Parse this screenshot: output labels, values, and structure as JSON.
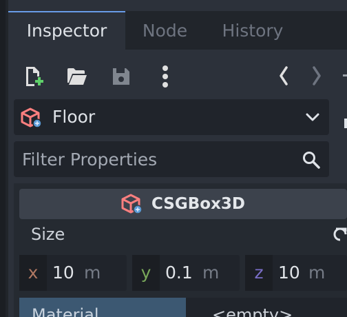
{
  "tabs": [
    {
      "label": "Inspector",
      "active": true
    },
    {
      "label": "Node",
      "active": false
    },
    {
      "label": "History",
      "active": false
    }
  ],
  "toolbar": {
    "icons": [
      "new-resource-icon",
      "open-folder-icon",
      "save-icon",
      "more-options-icon",
      "history-back-icon",
      "history-forward-icon"
    ]
  },
  "node_selector": {
    "name": "Floor",
    "icon": "csg-box-icon"
  },
  "filter": {
    "placeholder": "Filter Properties"
  },
  "class_header": {
    "name": "CSGBox3D",
    "icon": "csg-box-icon"
  },
  "size_property": {
    "label": "Size",
    "x": {
      "axis": "x",
      "value": "10",
      "unit": "m"
    },
    "y": {
      "axis": "y",
      "value": "0.1",
      "unit": "m"
    },
    "z": {
      "axis": "z",
      "value": "10",
      "unit": "m"
    }
  },
  "material_property": {
    "label": "Material",
    "value": "<empty>"
  },
  "colors": {
    "accent": "#699ce8",
    "csg_icon": "#fc7f7f",
    "axis_x": "#b07862",
    "axis_y": "#79a85a",
    "axis_z": "#7a6ec7"
  }
}
